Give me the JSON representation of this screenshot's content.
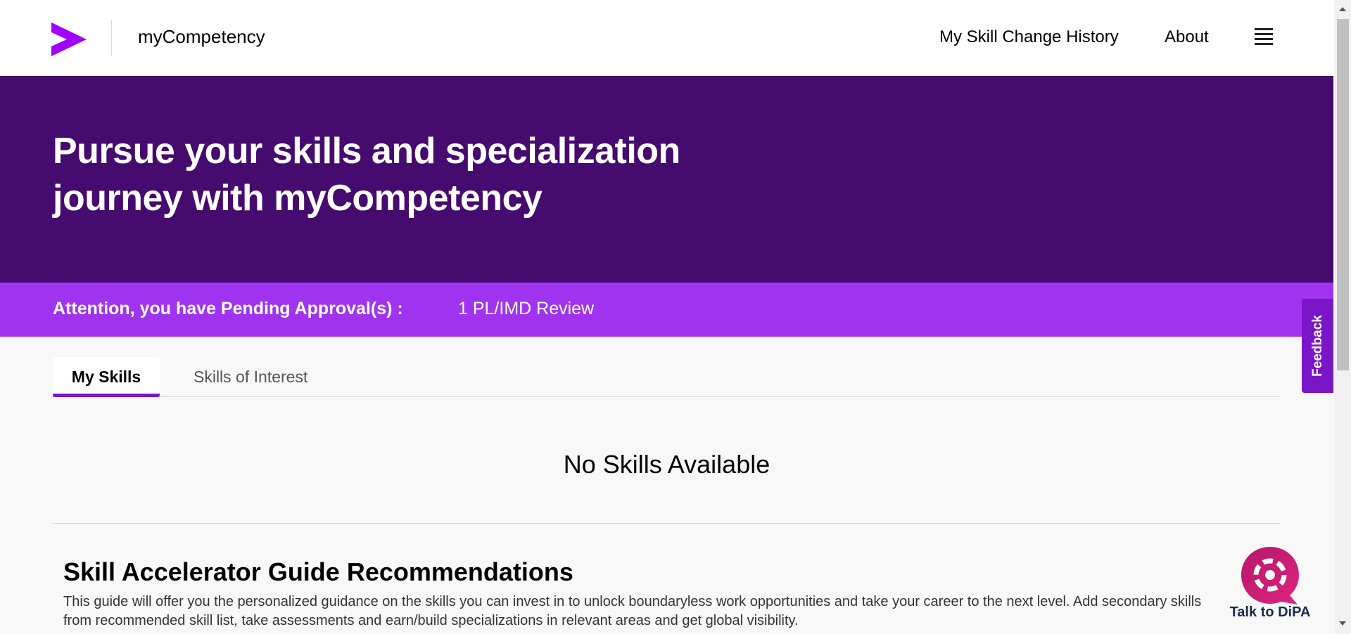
{
  "header": {
    "logo_icon": "accenture-chevron-logo",
    "app_name": "myCompetency",
    "nav": [
      {
        "label": "My Skill Change History"
      },
      {
        "label": "About"
      }
    ],
    "menu_icon": "hamburger-menu-icon"
  },
  "hero": {
    "title": "Pursue your skills and specialization journey with myCompetency"
  },
  "banner": {
    "label": "Attention, you have Pending Approval(s) :",
    "link": "1 PL/IMD Review"
  },
  "tabs": [
    {
      "label": "My Skills",
      "active": true
    },
    {
      "label": "Skills of Interest",
      "active": false
    }
  ],
  "empty_state": "No Skills Available",
  "guide": {
    "title": "Skill Accelerator Guide Recommendations",
    "text": "This guide will offer you the personalized guidance on the skills you can invest in to unlock boundaryless work opportunities and take your career to the next level. Add secondary skills from recommended skill list, take assessments and earn/build specializations in relevant areas and get global visibility."
  },
  "feedback": {
    "label": "Feedback"
  },
  "chat": {
    "label": "Talk to DiPA",
    "icon": "chat-bubble-icon"
  },
  "colors": {
    "brand_purple": "#a100ff",
    "hero_bg": "#460b6e",
    "banner_bg": "#a033f0",
    "accent": "#7b16c8",
    "chat_pink": "#c2185b"
  }
}
